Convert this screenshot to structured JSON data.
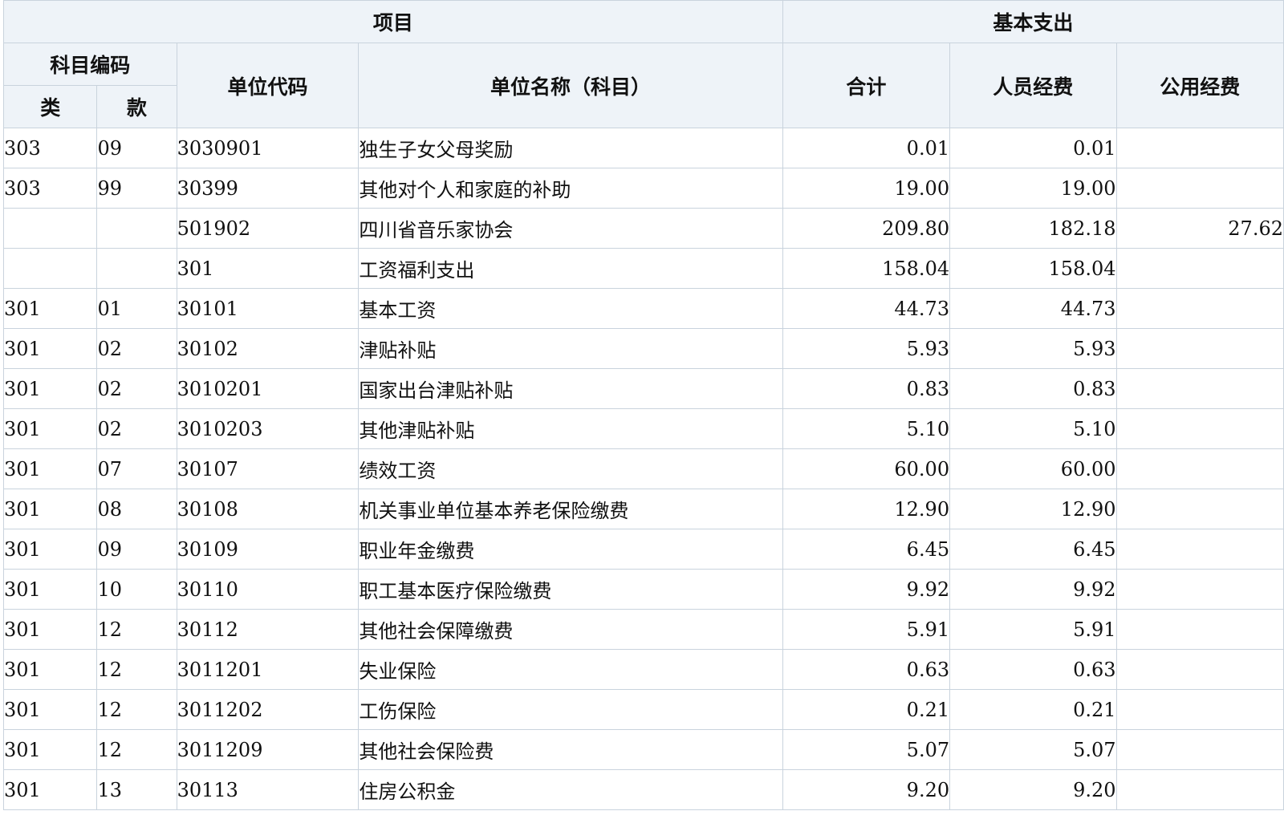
{
  "header": {
    "project": "项目",
    "basic_expense": "基本支出",
    "subject_code": "科目编码",
    "unit_code": "单位代码",
    "unit_name": "单位名称（科目）",
    "total": "合计",
    "personnel": "人员经费",
    "public": "公用经费",
    "lei": "类",
    "kuan": "款"
  },
  "rows": [
    {
      "lei": "303",
      "kuan": "09",
      "code": "3030901",
      "name": "独生子女父母奖励",
      "total": "0.01",
      "personnel": "0.01",
      "public": ""
    },
    {
      "lei": "303",
      "kuan": "99",
      "code": "30399",
      "name": "其他对个人和家庭的补助",
      "total": "19.00",
      "personnel": "19.00",
      "public": ""
    },
    {
      "lei": "",
      "kuan": "",
      "code": "501902",
      "name": "四川省音乐家协会",
      "total": "209.80",
      "personnel": "182.18",
      "public": "27.62"
    },
    {
      "lei": "",
      "kuan": "",
      "code": "301",
      "name": "工资福利支出",
      "total": "158.04",
      "personnel": "158.04",
      "public": ""
    },
    {
      "lei": "301",
      "kuan": "01",
      "code": "30101",
      "name": "基本工资",
      "total": "44.73",
      "personnel": "44.73",
      "public": ""
    },
    {
      "lei": "301",
      "kuan": "02",
      "code": "30102",
      "name": "津贴补贴",
      "total": "5.93",
      "personnel": "5.93",
      "public": ""
    },
    {
      "lei": "301",
      "kuan": "02",
      "code": "3010201",
      "name": "国家出台津贴补贴",
      "total": "0.83",
      "personnel": "0.83",
      "public": ""
    },
    {
      "lei": "301",
      "kuan": "02",
      "code": "3010203",
      "name": "其他津贴补贴",
      "total": "5.10",
      "personnel": "5.10",
      "public": ""
    },
    {
      "lei": "301",
      "kuan": "07",
      "code": "30107",
      "name": "绩效工资",
      "total": "60.00",
      "personnel": "60.00",
      "public": ""
    },
    {
      "lei": "301",
      "kuan": "08",
      "code": "30108",
      "name": "机关事业单位基本养老保险缴费",
      "total": "12.90",
      "personnel": "12.90",
      "public": ""
    },
    {
      "lei": "301",
      "kuan": "09",
      "code": "30109",
      "name": "职业年金缴费",
      "total": "6.45",
      "personnel": "6.45",
      "public": ""
    },
    {
      "lei": "301",
      "kuan": "10",
      "code": "30110",
      "name": "职工基本医疗保险缴费",
      "total": "9.92",
      "personnel": "9.92",
      "public": ""
    },
    {
      "lei": "301",
      "kuan": "12",
      "code": "30112",
      "name": "其他社会保障缴费",
      "total": "5.91",
      "personnel": "5.91",
      "public": ""
    },
    {
      "lei": "301",
      "kuan": "12",
      "code": "3011201",
      "name": "失业保险",
      "total": "0.63",
      "personnel": "0.63",
      "public": ""
    },
    {
      "lei": "301",
      "kuan": "12",
      "code": "3011202",
      "name": "工伤保险",
      "total": "0.21",
      "personnel": "0.21",
      "public": ""
    },
    {
      "lei": "301",
      "kuan": "12",
      "code": "3011209",
      "name": "其他社会保险费",
      "total": "5.07",
      "personnel": "5.07",
      "public": ""
    },
    {
      "lei": "301",
      "kuan": "13",
      "code": "30113",
      "name": "住房公积金",
      "total": "9.20",
      "personnel": "9.20",
      "public": ""
    }
  ]
}
